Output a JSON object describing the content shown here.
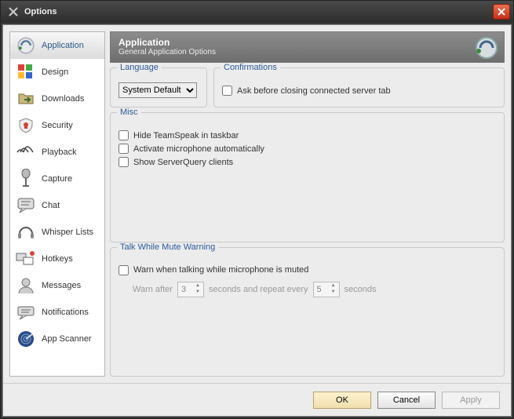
{
  "window": {
    "title": "Options"
  },
  "sidebar": {
    "items": [
      {
        "label": "Application",
        "icon": "speaker"
      },
      {
        "label": "Design",
        "icon": "palette"
      },
      {
        "label": "Downloads",
        "icon": "folder"
      },
      {
        "label": "Security",
        "icon": "shield"
      },
      {
        "label": "Playback",
        "icon": "sound"
      },
      {
        "label": "Capture",
        "icon": "mic"
      },
      {
        "label": "Chat",
        "icon": "chat"
      },
      {
        "label": "Whisper Lists",
        "icon": "headset"
      },
      {
        "label": "Hotkeys",
        "icon": "hotkeys"
      },
      {
        "label": "Messages",
        "icon": "user"
      },
      {
        "label": "Notifications",
        "icon": "notify"
      },
      {
        "label": "App Scanner",
        "icon": "radar"
      }
    ],
    "selectedIndex": 0
  },
  "header": {
    "title": "Application",
    "subtitle": "General Application Options"
  },
  "language": {
    "legend": "Language",
    "value": "System Default"
  },
  "confirmations": {
    "legend": "Confirmations",
    "ask_close_label": "Ask before closing connected server tab",
    "ask_close_checked": false
  },
  "misc": {
    "legend": "Misc",
    "hide_taskbar_label": "Hide TeamSpeak in taskbar",
    "hide_taskbar_checked": false,
    "auto_mic_label": "Activate microphone automatically",
    "auto_mic_checked": false,
    "show_sq_label": "Show ServerQuery clients",
    "show_sq_checked": false
  },
  "mute_warning": {
    "legend": "Talk While Mute Warning",
    "warn_label": "Warn when talking while microphone is muted",
    "warn_checked": false,
    "warn_after_prefix": "Warn after",
    "warn_after_value": "3",
    "warn_after_mid": "seconds and repeat every",
    "repeat_value": "5",
    "suffix": "seconds"
  },
  "buttons": {
    "ok": "OK",
    "cancel": "Cancel",
    "apply": "Apply"
  }
}
